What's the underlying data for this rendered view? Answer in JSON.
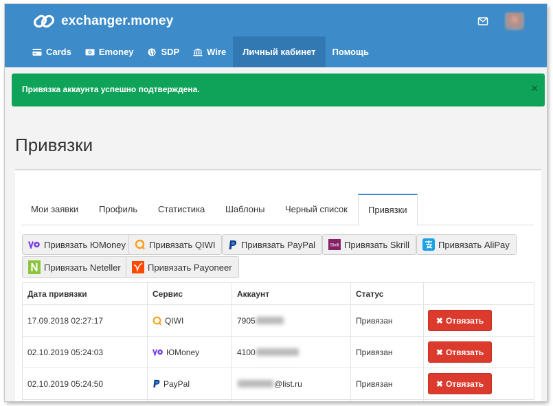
{
  "brand": {
    "name": "exchanger.money"
  },
  "header": {
    "mail_icon": "envelope-icon",
    "avatar": "user-avatar"
  },
  "nav": [
    {
      "label": "Cards",
      "icon": "card-icon"
    },
    {
      "label": "Emoney",
      "icon": "money-icon"
    },
    {
      "label": "SDP",
      "icon": "globe-icon"
    },
    {
      "label": "Wire",
      "icon": "bank-icon"
    },
    {
      "label": "Личный кабинет",
      "active": true
    },
    {
      "label": "Помощь"
    }
  ],
  "alert": {
    "text": "Привязка аккаунта успешно подтверждена.",
    "close": "×",
    "color": "#0fa35a"
  },
  "page": {
    "title": "Привязки"
  },
  "tabs": [
    {
      "label": "Мои заявки"
    },
    {
      "label": "Профиль"
    },
    {
      "label": "Статистика"
    },
    {
      "label": "Шаблоны"
    },
    {
      "label": "Черный список"
    },
    {
      "label": "Привязки",
      "active": true
    }
  ],
  "bind_buttons": [
    {
      "label": "Привязать ЮMoney",
      "icon": "yoomoney-icon"
    },
    {
      "label": "Привязать QIWI",
      "icon": "qiwi-icon"
    },
    {
      "label": "Привязать PayPal",
      "icon": "paypal-icon"
    },
    {
      "label": "Привязать Skrill",
      "icon": "skrill-icon"
    },
    {
      "label": "Привязать AliPay",
      "icon": "alipay-icon"
    },
    {
      "label": "Привязать Neteller",
      "icon": "neteller-icon"
    },
    {
      "label": "Привязать Payoneer",
      "icon": "payoneer-icon"
    }
  ],
  "table": {
    "headers": [
      "Дата привязки",
      "Сервис",
      "Аккаунт",
      "Статус",
      ""
    ],
    "rows": [
      {
        "date": "17.09.2018 02:27:17",
        "service": "QIWI",
        "service_icon": "qiwi-icon",
        "account_visible": "7905",
        "account_suffix": "",
        "status": "Привязан",
        "action": "Отвязать"
      },
      {
        "date": "02.10.2019 05:24:03",
        "service": "ЮMoney",
        "service_icon": "yoomoney-icon",
        "account_visible": "4100",
        "account_suffix": "",
        "status": "Привязан",
        "action": "Отвязать"
      },
      {
        "date": "02.10.2019 05:24:50",
        "service": "PayPal",
        "service_icon": "paypal-icon",
        "account_visible": "",
        "account_suffix": "@list.ru",
        "status": "Привязан",
        "action": "Отвязать"
      }
    ]
  },
  "colors": {
    "header": "#3d8cc9",
    "active_nav": "#3279b3",
    "danger": "#db3a2c"
  }
}
